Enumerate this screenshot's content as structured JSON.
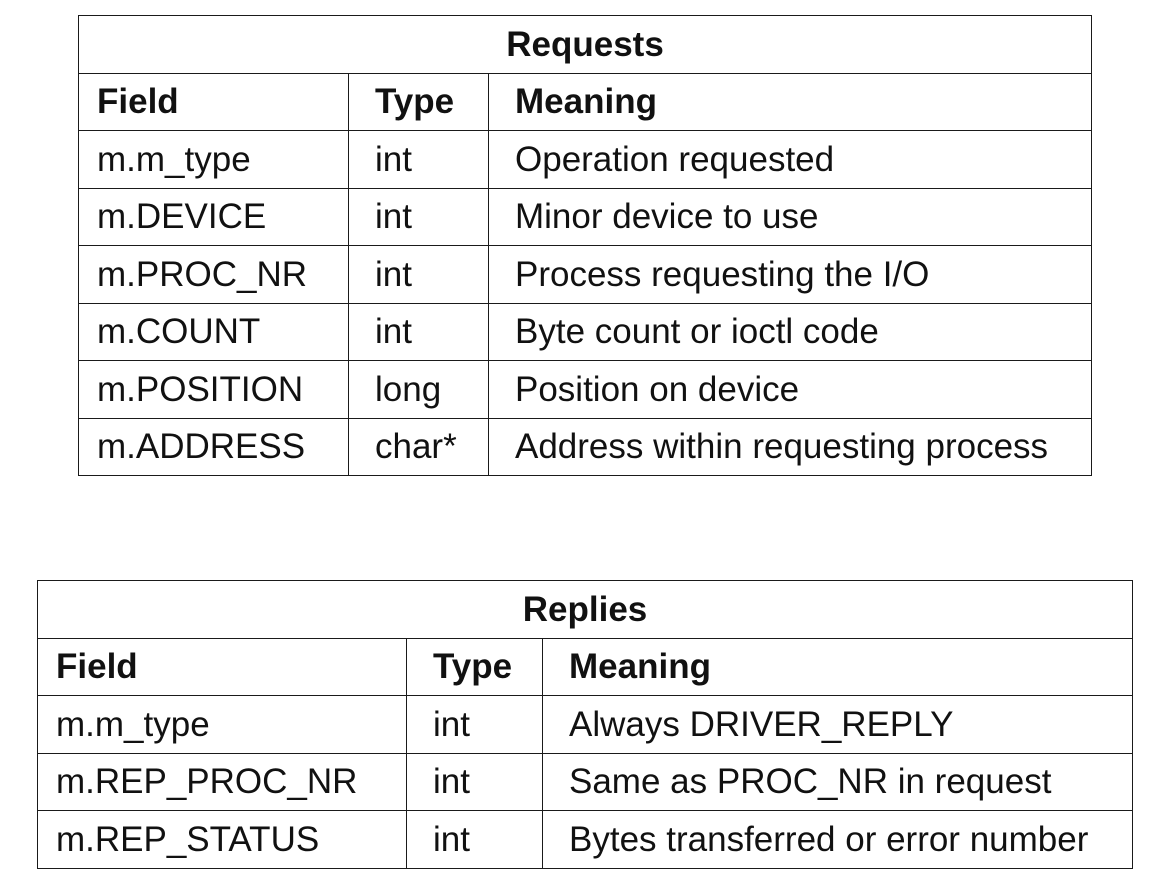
{
  "requests": {
    "title": "Requests",
    "headers": {
      "field": "Field",
      "type": "Type",
      "meaning": "Meaning"
    },
    "rows": [
      {
        "field": "m.m_type",
        "type": "int",
        "meaning": "Operation requested"
      },
      {
        "field": "m.DEVICE",
        "type": "int",
        "meaning": "Minor device to use"
      },
      {
        "field": "m.PROC_NR",
        "type": "int",
        "meaning": "Process requesting the I/O"
      },
      {
        "field": "m.COUNT",
        "type": "int",
        "meaning": "Byte count or ioctl code"
      },
      {
        "field": "m.POSITION",
        "type": "long",
        "meaning": "Position on device"
      },
      {
        "field": "m.ADDRESS",
        "type": "char*",
        "meaning": "Address within requesting process"
      }
    ]
  },
  "replies": {
    "title": "Replies",
    "headers": {
      "field": "Field",
      "type": "Type",
      "meaning": "Meaning"
    },
    "rows": [
      {
        "field": "m.m_type",
        "type": "int",
        "meaning": "Always DRIVER_REPLY"
      },
      {
        "field": "m.REP_PROC_NR",
        "type": "int",
        "meaning": "Same as PROC_NR in request"
      },
      {
        "field": "m.REP_STATUS",
        "type": "int",
        "meaning": "Bytes transferred or error number"
      }
    ]
  }
}
